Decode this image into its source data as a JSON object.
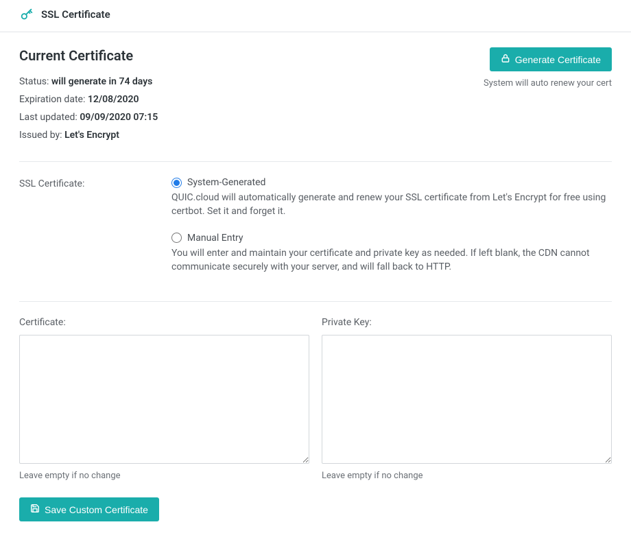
{
  "header": {
    "title": "SSL Certificate"
  },
  "current": {
    "section_title": "Current Certificate",
    "status_label": "Status:",
    "status_value": "will generate in 74 days",
    "expiration_label": "Expiration date:",
    "expiration_value": "12/08/2020",
    "lastupdated_label": "Last updated:",
    "lastupdated_value": "09/09/2020 07:15",
    "issuedby_label": "Issued by:",
    "issuedby_value": "Let's Encrypt"
  },
  "generate": {
    "button_label": "Generate Certificate",
    "helper": "System will auto renew your cert"
  },
  "ssl_mode": {
    "label": "SSL Certificate:",
    "options": [
      {
        "value": "system",
        "title": "System-Generated",
        "description": "QUIC.cloud will automatically generate and renew your SSL certificate from Let's Encrypt for free using certbot. Set it and forget it.",
        "checked": true
      },
      {
        "value": "manual",
        "title": "Manual Entry",
        "description": "You will enter and maintain your certificate and private key as needed. If left blank, the CDN cannot communicate securely with your server, and will fall back to HTTP.",
        "checked": false
      }
    ]
  },
  "certificate": {
    "label": "Certificate:",
    "hint": "Leave empty if no change"
  },
  "private_key": {
    "label": "Private Key:",
    "hint": "Leave empty if no change"
  },
  "save": {
    "button_label": "Save Custom Certificate"
  }
}
